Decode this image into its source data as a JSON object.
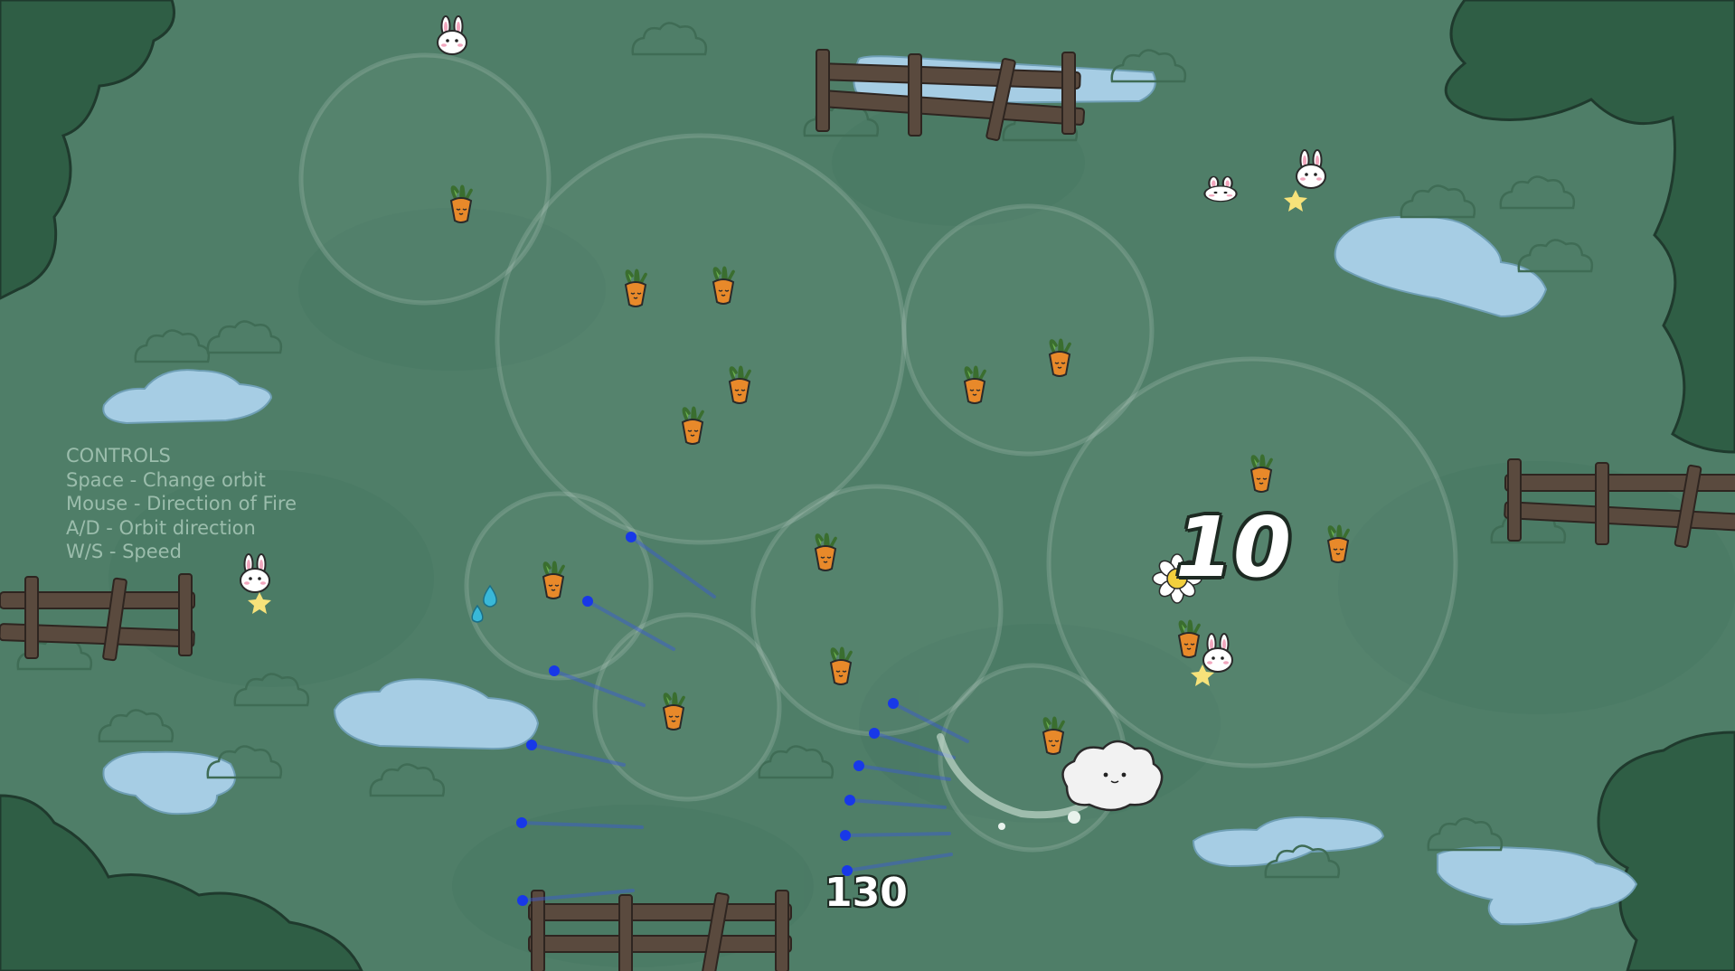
{
  "controls": {
    "title": "CONTROLS",
    "lines": [
      "Space - Change orbit",
      "Mouse - Direction of Fire",
      "A/D - Orbit direction",
      "W/S - Speed"
    ]
  },
  "hud": {
    "score": "130",
    "combo": "10"
  },
  "colors": {
    "grass": "#4f7e68",
    "puddle": "#a6cde4",
    "bush": "#2f5e45",
    "fence": "#5a4a3e",
    "bullet": "#1838e8",
    "carrot": "#e8892a",
    "water_drop": "#39b8d8"
  },
  "entities": {
    "player": "cloud-player",
    "enemies": "bunny-enemy",
    "pickups": "carrot-pickup",
    "powerup": "water-drop-powerup",
    "flower": "daisy-flower"
  }
}
